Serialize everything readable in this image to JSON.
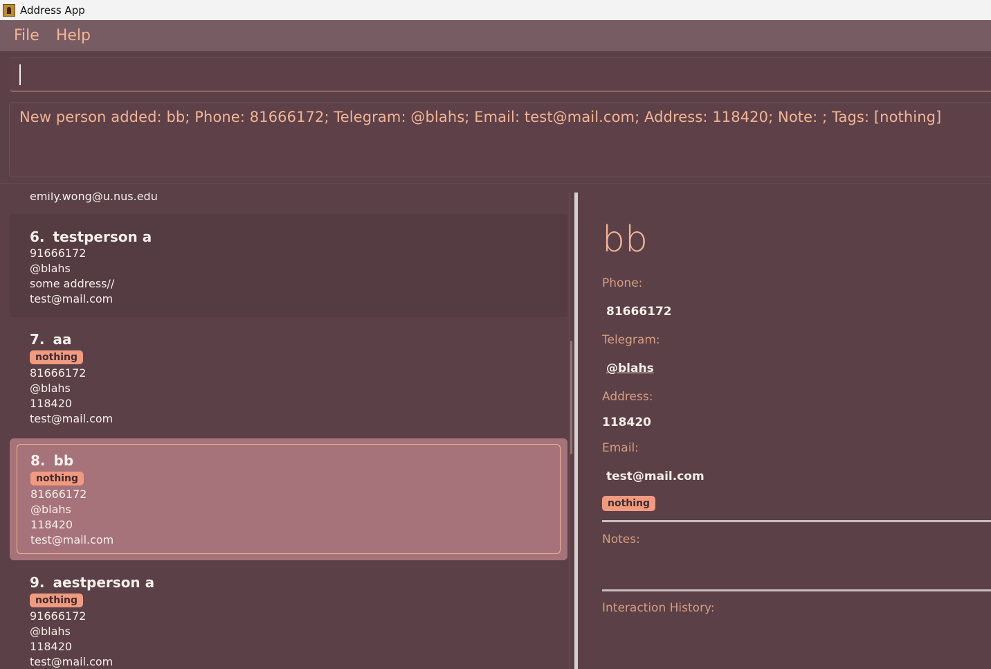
{
  "window": {
    "title": "Address App"
  },
  "menu": {
    "file": "File",
    "help": "Help"
  },
  "command": {
    "value": ""
  },
  "result": {
    "text": "New person added: bb; Phone: 81666172; Telegram: @blahs; Email: test@mail.com; Address: 118420; Note: ; Tags: [nothing]"
  },
  "list": {
    "partial_email": "emily.wong@u.nus.edu",
    "people": [
      {
        "index": "6.",
        "name": "testperson a",
        "tags": [],
        "phone": "91666172",
        "telegram": "@blahs",
        "address": "some address//",
        "email": "test@mail.com"
      },
      {
        "index": "7.",
        "name": "aa",
        "tag": "nothing",
        "phone": "81666172",
        "telegram": "@blahs",
        "address": "118420",
        "email": "test@mail.com"
      },
      {
        "index": "8.",
        "name": "bb",
        "tag": "nothing",
        "phone": "81666172",
        "telegram": "@blahs",
        "address": "118420",
        "email": "test@mail.com"
      },
      {
        "index": "9.",
        "name": "aestperson a",
        "tag": "nothing",
        "phone": "91666172",
        "telegram": "@blahs",
        "address": "118420",
        "email": "test@mail.com"
      }
    ]
  },
  "detail": {
    "name": "bb",
    "phone_label": "Phone:",
    "phone": "81666172",
    "telegram_label": "Telegram:",
    "telegram": "@blahs",
    "address_label": "Address:",
    "address": "118420",
    "email_label": "Email:",
    "email": "test@mail.com",
    "tag": "nothing",
    "notes_label": "Notes:",
    "history_label": "Interaction History:"
  },
  "colors": {
    "background": "#5b4047",
    "accent": "#f2b595",
    "tag": "#f09a80",
    "selected": "#a7737a"
  }
}
